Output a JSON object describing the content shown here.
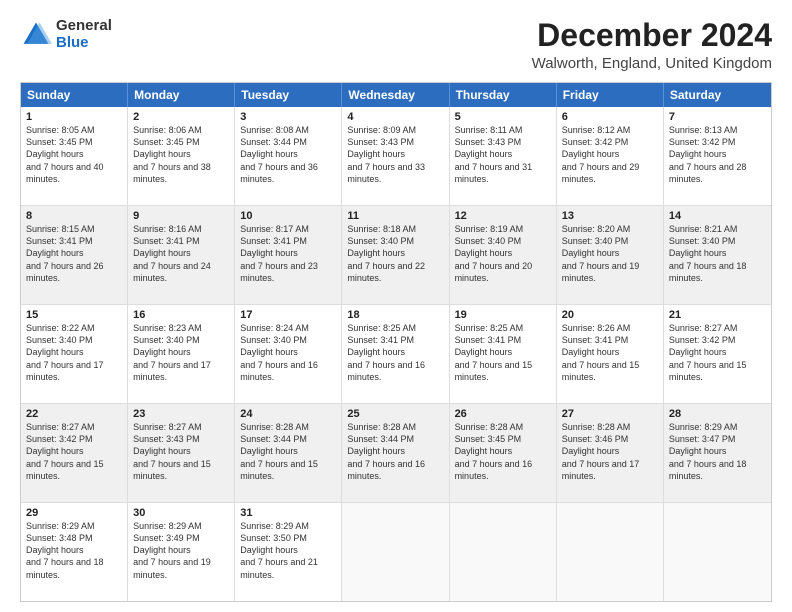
{
  "logo": {
    "general": "General",
    "blue": "Blue"
  },
  "title": "December 2024",
  "location": "Walworth, England, United Kingdom",
  "days": [
    "Sunday",
    "Monday",
    "Tuesday",
    "Wednesday",
    "Thursday",
    "Friday",
    "Saturday"
  ],
  "weeks": [
    [
      {
        "day": "1",
        "rise": "8:05 AM",
        "set": "3:45 PM",
        "hours": "7 hours and 40 minutes."
      },
      {
        "day": "2",
        "rise": "8:06 AM",
        "set": "3:45 PM",
        "hours": "7 hours and 38 minutes."
      },
      {
        "day": "3",
        "rise": "8:08 AM",
        "set": "3:44 PM",
        "hours": "7 hours and 36 minutes."
      },
      {
        "day": "4",
        "rise": "8:09 AM",
        "set": "3:43 PM",
        "hours": "7 hours and 33 minutes."
      },
      {
        "day": "5",
        "rise": "8:11 AM",
        "set": "3:43 PM",
        "hours": "7 hours and 31 minutes."
      },
      {
        "day": "6",
        "rise": "8:12 AM",
        "set": "3:42 PM",
        "hours": "7 hours and 29 minutes."
      },
      {
        "day": "7",
        "rise": "8:13 AM",
        "set": "3:42 PM",
        "hours": "7 hours and 28 minutes."
      }
    ],
    [
      {
        "day": "8",
        "rise": "8:15 AM",
        "set": "3:41 PM",
        "hours": "7 hours and 26 minutes."
      },
      {
        "day": "9",
        "rise": "8:16 AM",
        "set": "3:41 PM",
        "hours": "7 hours and 24 minutes."
      },
      {
        "day": "10",
        "rise": "8:17 AM",
        "set": "3:41 PM",
        "hours": "7 hours and 23 minutes."
      },
      {
        "day": "11",
        "rise": "8:18 AM",
        "set": "3:40 PM",
        "hours": "7 hours and 22 minutes."
      },
      {
        "day": "12",
        "rise": "8:19 AM",
        "set": "3:40 PM",
        "hours": "7 hours and 20 minutes."
      },
      {
        "day": "13",
        "rise": "8:20 AM",
        "set": "3:40 PM",
        "hours": "7 hours and 19 minutes."
      },
      {
        "day": "14",
        "rise": "8:21 AM",
        "set": "3:40 PM",
        "hours": "7 hours and 18 minutes."
      }
    ],
    [
      {
        "day": "15",
        "rise": "8:22 AM",
        "set": "3:40 PM",
        "hours": "7 hours and 17 minutes."
      },
      {
        "day": "16",
        "rise": "8:23 AM",
        "set": "3:40 PM",
        "hours": "7 hours and 17 minutes."
      },
      {
        "day": "17",
        "rise": "8:24 AM",
        "set": "3:40 PM",
        "hours": "7 hours and 16 minutes."
      },
      {
        "day": "18",
        "rise": "8:25 AM",
        "set": "3:41 PM",
        "hours": "7 hours and 16 minutes."
      },
      {
        "day": "19",
        "rise": "8:25 AM",
        "set": "3:41 PM",
        "hours": "7 hours and 15 minutes."
      },
      {
        "day": "20",
        "rise": "8:26 AM",
        "set": "3:41 PM",
        "hours": "7 hours and 15 minutes."
      },
      {
        "day": "21",
        "rise": "8:27 AM",
        "set": "3:42 PM",
        "hours": "7 hours and 15 minutes."
      }
    ],
    [
      {
        "day": "22",
        "rise": "8:27 AM",
        "set": "3:42 PM",
        "hours": "7 hours and 15 minutes."
      },
      {
        "day": "23",
        "rise": "8:27 AM",
        "set": "3:43 PM",
        "hours": "7 hours and 15 minutes."
      },
      {
        "day": "24",
        "rise": "8:28 AM",
        "set": "3:44 PM",
        "hours": "7 hours and 15 minutes."
      },
      {
        "day": "25",
        "rise": "8:28 AM",
        "set": "3:44 PM",
        "hours": "7 hours and 16 minutes."
      },
      {
        "day": "26",
        "rise": "8:28 AM",
        "set": "3:45 PM",
        "hours": "7 hours and 16 minutes."
      },
      {
        "day": "27",
        "rise": "8:28 AM",
        "set": "3:46 PM",
        "hours": "7 hours and 17 minutes."
      },
      {
        "day": "28",
        "rise": "8:29 AM",
        "set": "3:47 PM",
        "hours": "7 hours and 18 minutes."
      }
    ],
    [
      {
        "day": "29",
        "rise": "8:29 AM",
        "set": "3:48 PM",
        "hours": "7 hours and 18 minutes."
      },
      {
        "day": "30",
        "rise": "8:29 AM",
        "set": "3:49 PM",
        "hours": "7 hours and 19 minutes."
      },
      {
        "day": "31",
        "rise": "8:29 AM",
        "set": "3:50 PM",
        "hours": "7 hours and 21 minutes."
      },
      null,
      null,
      null,
      null
    ]
  ]
}
